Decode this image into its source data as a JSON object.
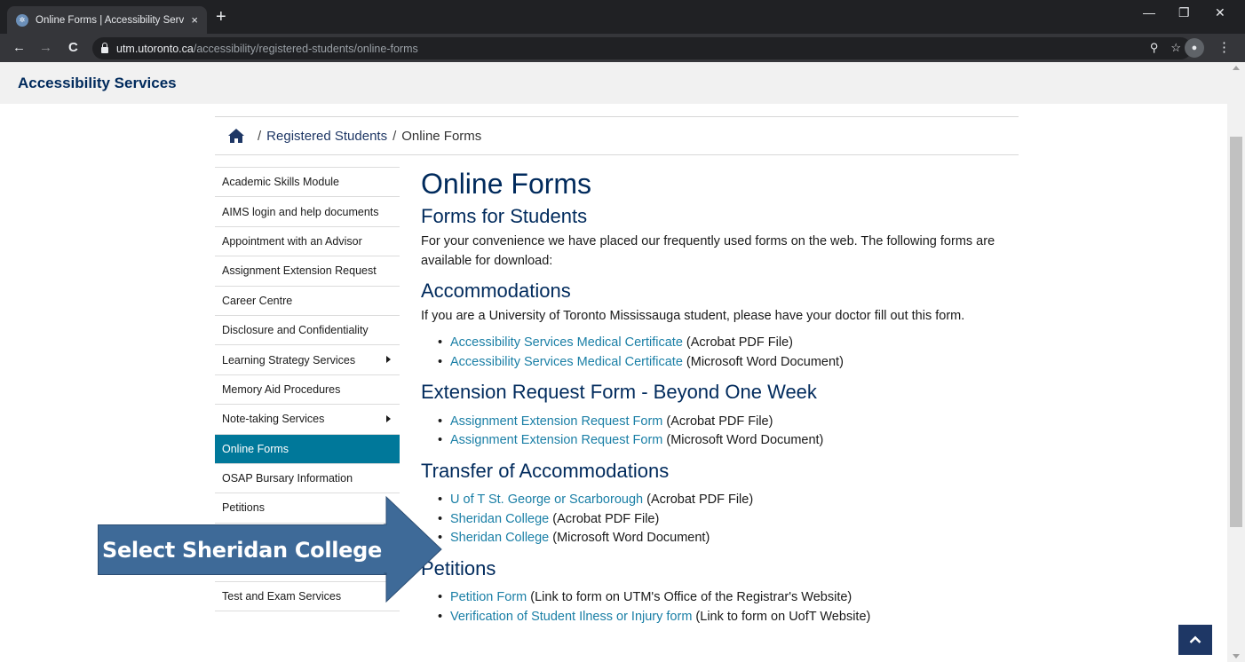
{
  "browser": {
    "tab_title": "Online Forms | Accessibility Servi",
    "tab_close": "×",
    "new_tab": "+",
    "win_minimize": "—",
    "win_restore": "❐",
    "win_close": "✕",
    "back": "←",
    "forward": "→",
    "reload": "C",
    "url_host": "utm.utoronto.ca",
    "url_path": "/accessibility/registered-students/online-forms",
    "zoom_icon": "⚲",
    "star_icon": "☆",
    "menu_icon": "⋮"
  },
  "site": {
    "name": "Accessibility Services"
  },
  "breadcrumb": {
    "items": [
      "Registered Students",
      "Online Forms"
    ],
    "separator": "/"
  },
  "sidebar": {
    "items": [
      {
        "label": "Academic Skills Module",
        "active": false,
        "has_children": false
      },
      {
        "label": "AIMS login and help documents",
        "active": false,
        "has_children": false
      },
      {
        "label": "Appointment with an Advisor",
        "active": false,
        "has_children": false
      },
      {
        "label": "Assignment Extension Request",
        "active": false,
        "has_children": false
      },
      {
        "label": "Career Centre",
        "active": false,
        "has_children": false
      },
      {
        "label": "Disclosure and Confidentiality",
        "active": false,
        "has_children": false
      },
      {
        "label": "Learning Strategy Services",
        "active": false,
        "has_children": true
      },
      {
        "label": "Memory Aid Procedures",
        "active": false,
        "has_children": false
      },
      {
        "label": "Note-taking Services",
        "active": false,
        "has_children": true
      },
      {
        "label": "Online Forms",
        "active": true,
        "has_children": false
      },
      {
        "label": "OSAP Bursary Information",
        "active": false,
        "has_children": false
      },
      {
        "label": "Petitions",
        "active": false,
        "has_children": false
      },
      {
        "label": "",
        "active": false,
        "has_children": false
      },
      {
        "label": "",
        "active": false,
        "has_children": false
      },
      {
        "label": "Test and Exam Services",
        "active": false,
        "has_children": true
      }
    ]
  },
  "main": {
    "title": "Online Forms",
    "forms_heading": "Forms for Students",
    "intro": "For your convenience we have placed our frequently used forms on the web. The following forms are available for download:",
    "accommodations": {
      "heading": "Accommodations",
      "text": "If you are a University of Toronto Mississauga student, please have your doctor fill out this form.",
      "links": [
        {
          "link": "Accessibility Services Medical Certificate",
          "note": " (Acrobat PDF File)"
        },
        {
          "link": "Accessibility Services Medical Certificate",
          "note": " (Microsoft Word Document)"
        }
      ]
    },
    "extension": {
      "heading": "Extension Request Form - Beyond One Week",
      "links": [
        {
          "link": "Assignment Extension Request Form",
          "note": " (Acrobat PDF File)"
        },
        {
          "link": "Assignment Extension Request Form",
          "note": " (Microsoft Word Document)"
        }
      ]
    },
    "transfer": {
      "heading": "Transfer of Accommodations",
      "links": [
        {
          "link": "U of T St. George or Scarborough",
          "note": " (Acrobat PDF File)"
        },
        {
          "link": "Sheridan College",
          "note": " (Acrobat PDF File)"
        },
        {
          "link": "Sheridan College",
          "note": " (Microsoft Word Document)"
        }
      ]
    },
    "petitions": {
      "heading": "Petitions",
      "links": [
        {
          "link": "Petition Form",
          "note": " (Link to form on UTM's Office of the Registrar's Website)"
        },
        {
          "link": "Verification of Student Ilness or Injury form",
          "note": " (Link to form on UofT Website)"
        }
      ]
    }
  },
  "callout": {
    "text": "Select Sheridan College"
  },
  "colors": {
    "accent": "#00789a",
    "brand_navy": "#002a5c",
    "link": "#1a7fa6",
    "callout": "#3e6a98"
  }
}
